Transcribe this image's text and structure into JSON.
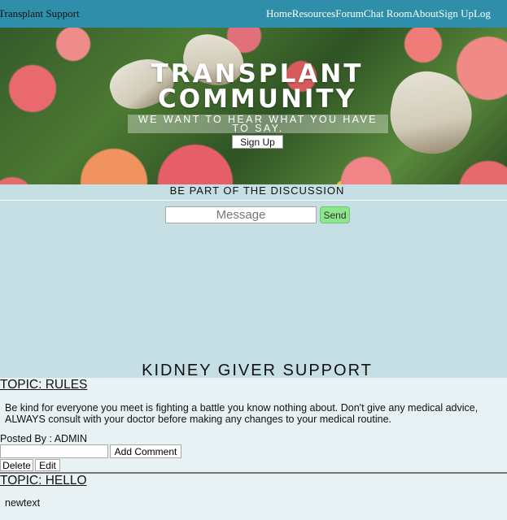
{
  "navbar": {
    "brand": "Transplant Support",
    "links": [
      {
        "label": "Home"
      },
      {
        "label": "Resources"
      },
      {
        "label": "Forum"
      },
      {
        "label": "Chat Room"
      },
      {
        "label": "About"
      },
      {
        "label": "Sign Up"
      },
      {
        "label": "Log"
      }
    ],
    "background_color": "#2f8eaa"
  },
  "hero": {
    "title_line1": "TRANSPLANT",
    "title_line2": "COMMUNITY",
    "subtitle": "WE WANT TO HEAR WHAT YOU HAVE TO SAY.",
    "signup_label": "Sign Up"
  },
  "discussion": {
    "heading": "BE PART OF THE DISCUSSION",
    "message_placeholder": "Message",
    "send_label": "Send",
    "send_color": "#8ee68a"
  },
  "forum": {
    "title": "KIDNEY GIVER SUPPORT",
    "topics": [
      {
        "title": "TOPIC: RULES",
        "body": "Be kind for everyone you meet is fighting a battle you know nothing about. Don't give any medical advice, ALWAYS consult with your doctor before making any changes to your medical routine.",
        "posted_by": "Posted By : ADMIN",
        "comment_value": "",
        "add_comment_label": "Add Comment",
        "delete_label": "Delete",
        "edit_label": "Edit"
      },
      {
        "title": "TOPIC: HELLO",
        "body": "newtext"
      }
    ]
  }
}
